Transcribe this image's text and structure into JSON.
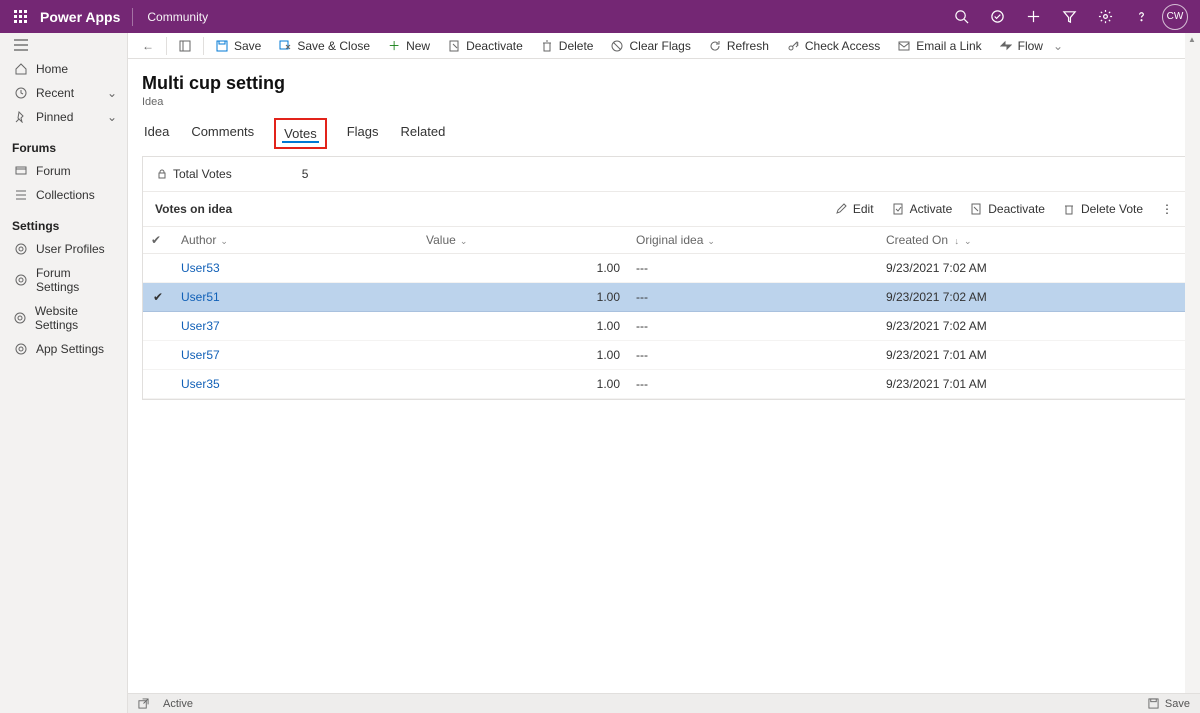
{
  "topbar": {
    "brand": "Power Apps",
    "crumb": "Community",
    "avatar_initials": "CW"
  },
  "leftnav": {
    "home": "Home",
    "recent": "Recent",
    "pinned": "Pinned",
    "section_forums": "Forums",
    "forum": "Forum",
    "collections": "Collections",
    "section_settings": "Settings",
    "user_profiles": "User Profiles",
    "forum_settings": "Forum Settings",
    "website_settings": "Website Settings",
    "app_settings": "App Settings"
  },
  "cmdbar": {
    "save": "Save",
    "save_close": "Save & Close",
    "new": "New",
    "deactivate": "Deactivate",
    "delete": "Delete",
    "clear_flags": "Clear Flags",
    "refresh": "Refresh",
    "check_access": "Check Access",
    "email_link": "Email a Link",
    "flow": "Flow"
  },
  "page": {
    "title": "Multi cup setting",
    "subtitle": "Idea"
  },
  "tabs": {
    "idea": "Idea",
    "comments": "Comments",
    "votes": "Votes",
    "flags": "Flags",
    "related": "Related"
  },
  "totals": {
    "label": "Total Votes",
    "value": "5"
  },
  "subgrid": {
    "title": "Votes on idea",
    "actions": {
      "edit": "Edit",
      "activate": "Activate",
      "deactivate": "Deactivate",
      "delete_vote": "Delete Vote"
    },
    "headers": {
      "author": "Author",
      "value": "Value",
      "original": "Original idea",
      "created": "Created On"
    },
    "rows": [
      {
        "author": "User53",
        "value": "1.00",
        "original": "---",
        "created": "9/23/2021 7:02 AM",
        "selected": false
      },
      {
        "author": "User51",
        "value": "1.00",
        "original": "---",
        "created": "9/23/2021 7:02 AM",
        "selected": true
      },
      {
        "author": "User37",
        "value": "1.00",
        "original": "---",
        "created": "9/23/2021 7:02 AM",
        "selected": false
      },
      {
        "author": "User57",
        "value": "1.00",
        "original": "---",
        "created": "9/23/2021 7:01 AM",
        "selected": false
      },
      {
        "author": "User35",
        "value": "1.00",
        "original": "---",
        "created": "9/23/2021 7:01 AM",
        "selected": false
      }
    ]
  },
  "statusbar": {
    "state": "Active",
    "save": "Save"
  }
}
